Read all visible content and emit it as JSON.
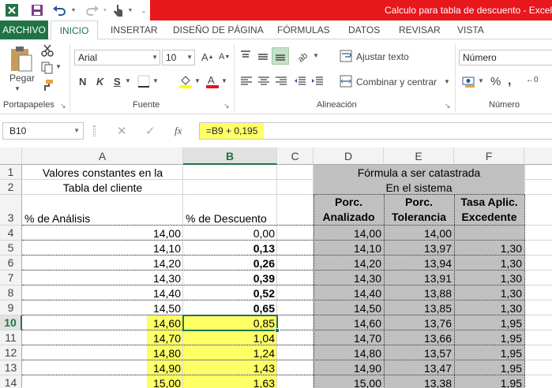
{
  "window": {
    "title": "Calculo para tabla de descuento -  Excel"
  },
  "quick_access": [
    "excel-logo-icon",
    "save-icon",
    "undo-icon",
    "redo-icon",
    "touch-mode-icon",
    "customize-icon"
  ],
  "tabs": [
    "ARCHIVO",
    "INICIO",
    "INSERTAR",
    "DISEÑO DE PÁGINA",
    "FÓRMULAS",
    "DATOS",
    "REVISAR",
    "VISTA"
  ],
  "ribbon": {
    "clipboard": {
      "paste_label": "Pegar",
      "group_label": "Portapapeles"
    },
    "font": {
      "font_name": "Arial",
      "font_size": "10",
      "bold": "N",
      "italic": "K",
      "underline": "S",
      "group_label": "Fuente"
    },
    "alignment": {
      "wrap_text": "Ajustar texto",
      "merge_center": "Combinar y centrar",
      "group_label": "Alineación"
    },
    "number": {
      "format": "Número",
      "percent": "%",
      "group_label": "Número"
    }
  },
  "formula_bar": {
    "name_box": "B10",
    "fx": "fx",
    "formula": "=B9 + 0,195"
  },
  "columns": [
    "A",
    "B",
    "C",
    "D",
    "E",
    "F"
  ],
  "rows": [
    "1",
    "2",
    "3",
    "4",
    "5",
    "6",
    "7",
    "8",
    "9",
    "10",
    "11",
    "12",
    "13",
    "14"
  ],
  "selected_cell": "B10",
  "header_cells": {
    "a1": "Valores constantes en la",
    "a2": "Tabla del cliente",
    "a3": "% de Análisis",
    "b3": "% de Descuento",
    "d1": "Fórmula a ser catastrada",
    "d2": "En el sistema",
    "d3a": "Porc.",
    "d3b": "Analizado",
    "e3a": "Porc.",
    "e3b": "Tolerancia",
    "f3a": "Tasa Aplic.",
    "f3b": "Excedente"
  },
  "table": [
    {
      "row": "4",
      "a": "14,00",
      "b": "0,00",
      "b_bold": false,
      "d": "14,00",
      "e": "14,00",
      "f": ""
    },
    {
      "row": "5",
      "a": "14,10",
      "b": "0,13",
      "b_bold": true,
      "d": "14,10",
      "e": "13,97",
      "f": "1,30"
    },
    {
      "row": "6",
      "a": "14,20",
      "b": "0,26",
      "b_bold": true,
      "d": "14,20",
      "e": "13,94",
      "f": "1,30"
    },
    {
      "row": "7",
      "a": "14,30",
      "b": "0,39",
      "b_bold": true,
      "d": "14,30",
      "e": "13,91",
      "f": "1,30"
    },
    {
      "row": "8",
      "a": "14,40",
      "b": "0,52",
      "b_bold": true,
      "d": "14,40",
      "e": "13,88",
      "f": "1,30"
    },
    {
      "row": "9",
      "a": "14,50",
      "b": "0,65",
      "b_bold": true,
      "d": "14,50",
      "e": "13,85",
      "f": "1,30"
    },
    {
      "row": "10",
      "a": "14,60",
      "b": "0,85",
      "b_bold": false,
      "d": "14,60",
      "e": "13,76",
      "f": "1,95"
    },
    {
      "row": "11",
      "a": "14,70",
      "b": "1,04",
      "b_bold": false,
      "d": "14,70",
      "e": "13,66",
      "f": "1,95"
    },
    {
      "row": "12",
      "a": "14,80",
      "b": "1,24",
      "b_bold": false,
      "d": "14,80",
      "e": "13,57",
      "f": "1,95"
    },
    {
      "row": "13",
      "a": "14,90",
      "b": "1,43",
      "b_bold": false,
      "d": "14,90",
      "e": "13,47",
      "f": "1,95"
    },
    {
      "row": "14",
      "a": "15,00",
      "b": "1,63",
      "b_bold": false,
      "d": "15,00",
      "e": "13,38",
      "f": "1,95"
    }
  ],
  "colors": {
    "excel_green": "#217346",
    "title_red": "#e8171c",
    "highlight_yellow": "#ffff66",
    "shade_grey": "#c0c0c0"
  }
}
